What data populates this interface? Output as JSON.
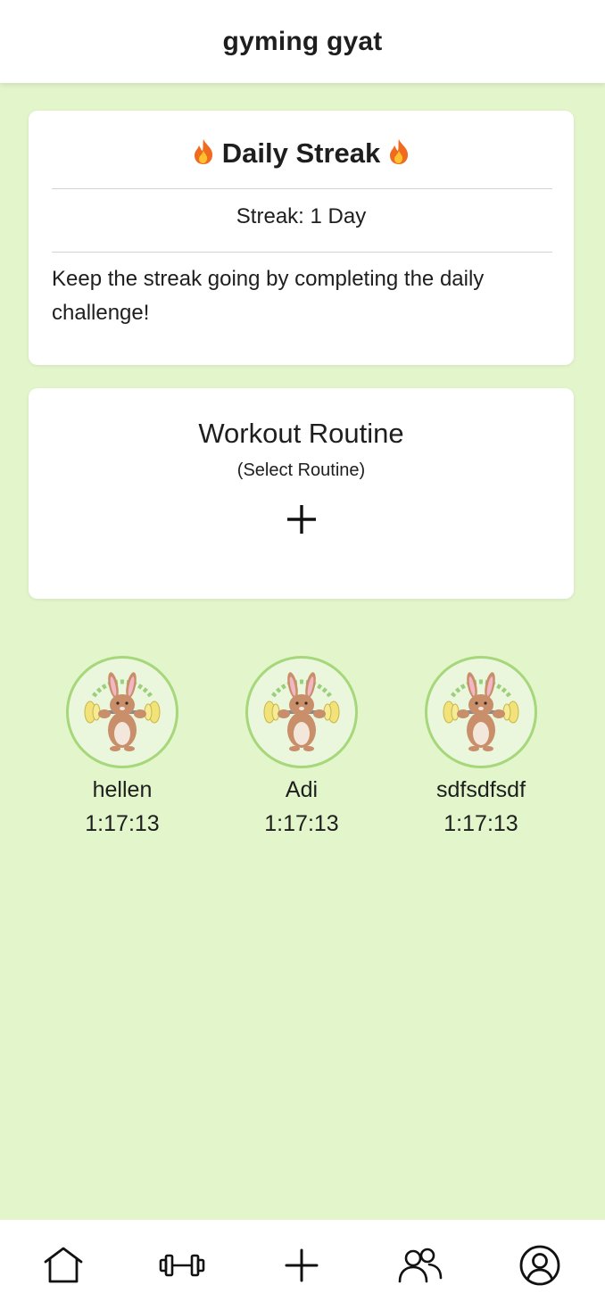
{
  "app": {
    "title": "gyming gyat"
  },
  "streak": {
    "title": "Daily Streak",
    "count_text": "Streak: 1 Day",
    "description": "Keep the streak going by completing the daily challenge!"
  },
  "routine": {
    "title": "Workout Routine",
    "subtitle": "(Select Routine)",
    "add_icon": "plus-icon"
  },
  "friends": [
    {
      "name": "hellen",
      "time": "1:17:13"
    },
    {
      "name": "Adi",
      "time": "1:17:13"
    },
    {
      "name": "sdfsdfsdf",
      "time": "1:17:13"
    }
  ],
  "nav": {
    "items": [
      "home-icon",
      "dumbbell-icon",
      "plus-icon",
      "friends-icon",
      "profile-icon"
    ]
  },
  "colors": {
    "background": "#e3f5cb",
    "avatar_border": "#a6d77a",
    "card": "#ffffff"
  }
}
